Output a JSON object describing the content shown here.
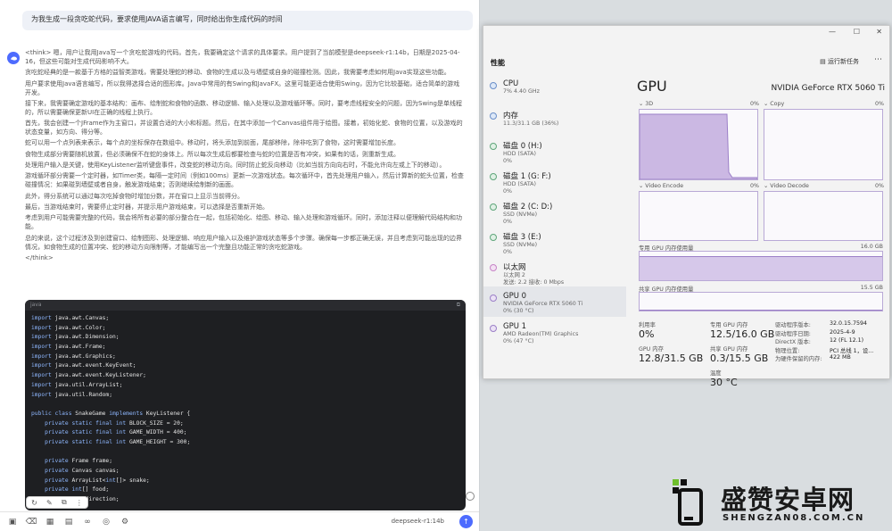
{
  "chat": {
    "prompt": "为我生成一段贪吃蛇代码，要求使用JAVA语言编写，同时给出你生成代码的时间",
    "think_paragraphs": [
      "<think> 嗯，用户让我用Java写一个贪吃蛇游戏的代码。首先，我要确定这个请求的具体要求。用户提到了当前模型是deepseek-r1:14b，日期是2025-04-16，但这些可能对生成代码影响不大。",
      "贪吃蛇经典的是一款基于方格的益智类游戏，需要处理蛇的移动、食物的生成以及与墙壁或自身的碰撞检测。因此，我需要考虑如何用Java实现这些功能。",
      "用户要求使用Java语言编写，所以我得选择合适的图形库。Java中常用的有Swing和JavaFX。这里可能更适合使用Swing，因为它比较基础，适合简单的游戏开发。",
      "接下来，我需要确定游戏的基本结构：画布、绘制蛇和食物的函数、移动逻辑、输入处理以及游戏循环等。同时，要考虑线程安全的问题，因为Swing是单线程的，所以需要确保更新UI在正确的线程上执行。",
      "首先，我会创建一个JFrame作为主窗口，并设置合适的大小和标题。然后，在其中添加一个Canvas组件用于绘图。接着，初始化蛇、食物的位置，以及游戏的状态变量，如方向、得分等。",
      "蛇可以用一个点列表来表示，每个点的坐标保存在数组中。移动时，将头添加到前面，尾部移除，除非吃到了食物，这时需要增加长度。",
      "食物生成部分需要随机放置，但必须确保不在蛇的身体上。所以每次生成后都要检查与蛇的位置是否有冲突，如果有的话，则重新生成。",
      "处理用户输入是关键，使用KeyListener监听键盘事件，改变蛇的移动方向。同时防止蛇反向移动（比如当前方向向右时，不能允许向左或上下的移动）。",
      "游戏循环部分需要一个定时器，如Timer类，每隔一定时间（例如100ms）更新一次游戏状态。每次循环中，首先处理用户输入，然后计算新的蛇头位置，检查碰撞情况：如果碰到墙壁或者自身，触发游戏结束；否则继续绘制新的画面。",
      "此外，得分系统可以通过每次吃掉食物时增加分数，并在窗口上显示当前得分。",
      "最后，当游戏结束时，需要停止定时器，并提示用户游戏结束，可以选择是否重新开始。",
      "考虑到用户可能需要完整的代码，我会将所有必要的部分整合在一起，包括初始化、绘图、移动、输入处理和游戏循环。同时，添加注释以便理解代码结构和功能。",
      "总的来说，这个过程涉及到创建窗口、绘制图形、处理逻辑、响应用户输入以及维护游戏状态等多个步骤。确保每一步都正确无误，并且考虑到可能出现的边界情况，如食物生成的位置冲突、蛇的移动方向限制等，才能编写出一个完整且功能正常的贪吃蛇游戏。",
      "</think>"
    ],
    "code_lang": "java",
    "code_lines": [
      "import java.awt.Canvas;",
      "import java.awt.Color;",
      "import java.awt.Dimension;",
      "import java.awt.Frame;",
      "import java.awt.Graphics;",
      "import java.awt.event.KeyEvent;",
      "import java.awt.event.KeyListener;",
      "import java.util.ArrayList;",
      "import java.util.Random;",
      "",
      "public class SnakeGame implements KeyListener {",
      "    private static final int BLOCK_SIZE = 20;",
      "    private static final int GAME_WIDTH = 400;",
      "    private static final int GAME_HEIGHT = 300;",
      "",
      "    private Frame frame;",
      "    private Canvas canvas;",
      "    private ArrayList<int[]> snake;",
      "    private int[] food;",
      "    private int direction;"
    ],
    "model_name": "deepseek-r1:14b"
  },
  "taskmanager": {
    "section_title": "性能",
    "run_task_label": "运行新任务",
    "sidebar": [
      {
        "name": "CPU",
        "sub1": "7%  4.40 GHz",
        "sub2": ""
      },
      {
        "name": "内存",
        "sub1": "11.3/31.1 GB (36%)",
        "sub2": ""
      },
      {
        "name": "磁盘 0 (H:)",
        "sub1": "HDD (SATA)",
        "sub2": "0%"
      },
      {
        "name": "磁盘 1 (G: F:)",
        "sub1": "HDD (SATA)",
        "sub2": "0%"
      },
      {
        "name": "磁盘 2 (C: D:)",
        "sub1": "SSD (NVMe)",
        "sub2": "0%"
      },
      {
        "name": "磁盘 3 (E:)",
        "sub1": "SSD (NVMe)",
        "sub2": "0%"
      },
      {
        "name": "以太网",
        "sub1": "以太网 2",
        "sub2": "发送: 2.2 接收: 0 Mbps"
      },
      {
        "name": "GPU 0",
        "sub1": "NVIDIA GeForce RTX 5060 Ti",
        "sub2": "0% (30 °C)"
      },
      {
        "name": "GPU 1",
        "sub1": "AMD Radeon(TM) Graphics",
        "sub2": "0% (47 °C)"
      }
    ],
    "gpu_title": "GPU",
    "gpu_model": "NVIDIA GeForce RTX 5060 Ti",
    "graphs": {
      "g3d_label": "3D",
      "g3d_pct": "0%",
      "copy_label": "Copy",
      "copy_pct": "0%",
      "vencode_label": "Video Encode",
      "vencode_pct": "0%",
      "vdecode_label": "Video Decode",
      "vdecode_pct": "0%",
      "dedicated_label": "专用 GPU 内存使用量",
      "dedicated_max": "16.0 GB",
      "shared_label": "共享 GPU 内存使用量",
      "shared_max": "15.5 GB"
    },
    "stats": {
      "util_label": "利用率",
      "util_value": "0%",
      "ded_label": "专用 GPU 内存",
      "ded_value": "12.5/16.0 GB",
      "gpu_mem_label": "GPU 内存",
      "gpu_mem_value": "12.8/31.5 GB",
      "shared_label": "共享 GPU 内存",
      "shared_value": "0.3/15.5 GB",
      "temp_label": "温度",
      "temp_value": "30 °C"
    },
    "info": [
      {
        "k": "驱动程序版本:",
        "v": "32.0.15.7594"
      },
      {
        "k": "驱动程序日期:",
        "v": "2025-4-9"
      },
      {
        "k": "DirectX 版本:",
        "v": "12 (FL 12.1)"
      },
      {
        "k": "物理位置:",
        "v": "PCI 总线 1，设..."
      },
      {
        "k": "为硬件保留的内存:",
        "v": "422 MB"
      }
    ]
  },
  "watermark": {
    "cn": "盛赞安卓网",
    "en": "SHENGZAN08.COM.CN"
  }
}
